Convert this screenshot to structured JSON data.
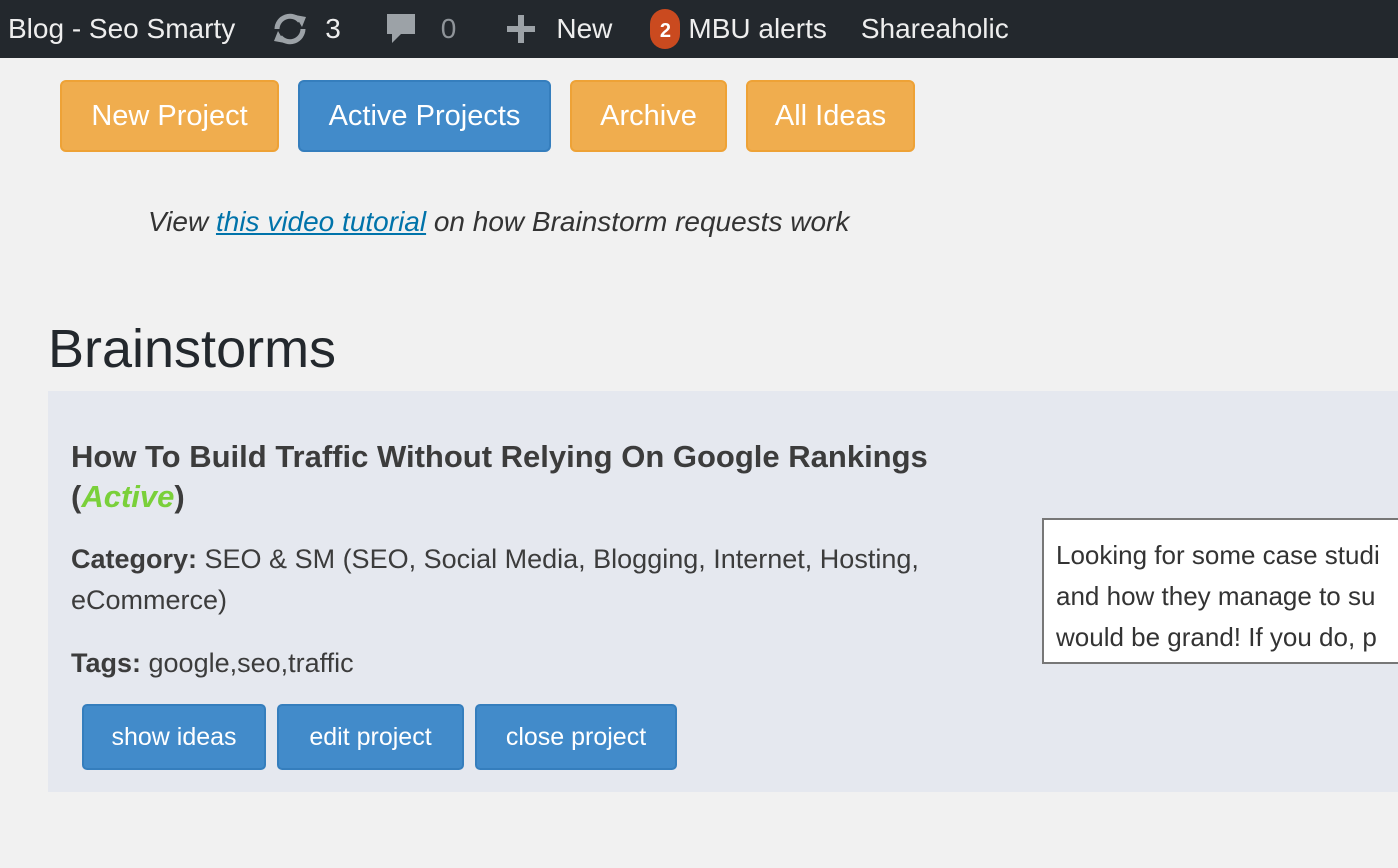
{
  "adminbar": {
    "site_name": "Blog - Seo Smarty",
    "updates_icon": "refresh-icon",
    "updates_count": "3",
    "comments_icon": "comment-icon",
    "comments_count": "0",
    "new_icon": "plus-icon",
    "new_label": "New",
    "mbu_badge": "2",
    "mbu_label": "MBU alerts",
    "shareaholic_label": "Shareaholic",
    "colors": {
      "bar": "#23282d",
      "badge": "#ca4a1f"
    }
  },
  "nav": {
    "new_project": "New Project",
    "active_projects": "Active Projects",
    "archive": "Archive",
    "all_ideas": "All Ideas",
    "colors": {
      "orange": "#f0ad4e",
      "blue": "#428bca"
    }
  },
  "tutorial": {
    "prefix": "View ",
    "link_text": "this video tutorial",
    "suffix": " on how Brainstorm requests work"
  },
  "heading": "Brainstorms",
  "project": {
    "title": "How To Build Traffic Without Relying On Google Rankings",
    "status_open": "(",
    "status": "Active",
    "status_close": ")",
    "category_label": "Category:",
    "category_value": " SEO & SM (SEO, Social Media, Blogging, Internet, Hosting, eCommerce)",
    "tags_label": "Tags:",
    "tags_value": " google,seo,traffic",
    "actions": {
      "show_ideas": "show ideas",
      "edit_project": "edit project",
      "close_project": "close project"
    },
    "description_lines": [
      "Looking for some case studi",
      "and how they manage to su",
      "would be grand! If you do, p"
    ],
    "colors": {
      "panel": "#e5e8ef",
      "status": "#7ad03a"
    }
  }
}
